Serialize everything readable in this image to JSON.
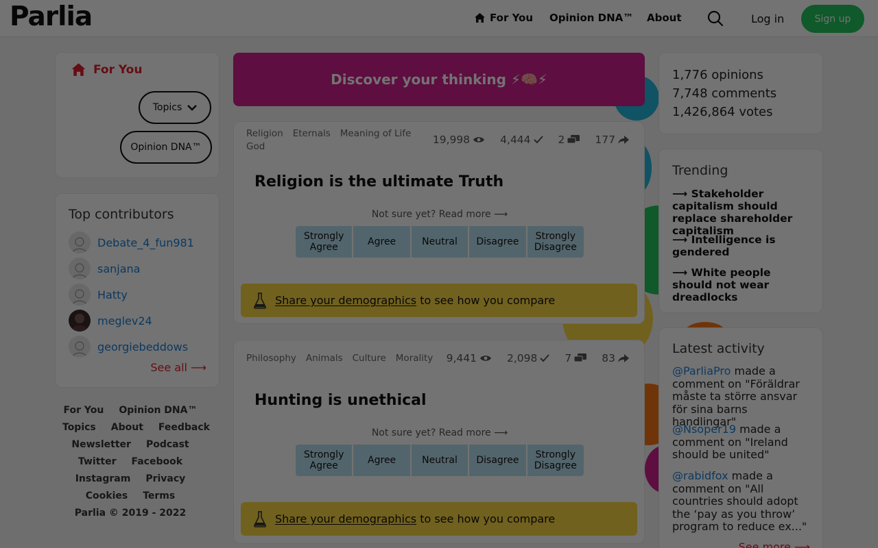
{
  "header": {
    "logo": "Parlia",
    "nav": [
      {
        "label": "For You",
        "icon": "home-icon"
      },
      {
        "label": "Opinion DNA™"
      },
      {
        "label": "About"
      }
    ],
    "login": "Log in",
    "signup": "Sign up"
  },
  "left_nav": {
    "for_you": "For You",
    "topics": "Topics",
    "opinion_dna": "Opinion DNA™"
  },
  "top_contributors": {
    "title": "Top contributors",
    "users": [
      "Debate_4_fun981",
      "sanjana",
      "Hatty",
      "meglev24",
      "georgiebeddows"
    ],
    "see_all": "See all ⟶"
  },
  "footer": {
    "rows": [
      [
        "For You",
        "Opinion DNA™"
      ],
      [
        "Topics",
        "About",
        "Feedback"
      ],
      [
        "Newsletter",
        "Podcast"
      ],
      [
        "Twitter",
        "Facebook"
      ],
      [
        "Instagram",
        "Privacy"
      ],
      [
        "Cookies",
        "Terms"
      ]
    ],
    "copyright": "Parlia © 2019 - 2022"
  },
  "banner": {
    "text": "Discover your thinking ⚡🧠⚡"
  },
  "cards": [
    {
      "tags": [
        "Religion",
        "Eternals",
        "Meaning of Life",
        "God"
      ],
      "views": "19,998",
      "votes": "4,444",
      "comments": "2",
      "shares": "177",
      "title": "Religion is the ultimate Truth",
      "readmore": "Not sure yet? Read more ⟶",
      "options": [
        "Strongly Agree",
        "Agree",
        "Neutral",
        "Disagree",
        "Strongly Disagree"
      ],
      "demo_link": "Share your demographics",
      "demo_rest": " to see how you compare"
    },
    {
      "tags": [
        "Philosophy",
        "Animals",
        "Culture",
        "Morality"
      ],
      "views": "9,441",
      "votes": "2,098",
      "comments": "7",
      "shares": "83",
      "title": "Hunting is unethical",
      "readmore": "Not sure yet? Read more ⟶",
      "options": [
        "Strongly Agree",
        "Agree",
        "Neutral",
        "Disagree",
        "Strongly Disagree"
      ],
      "demo_link": "Share your demographics",
      "demo_rest": " to see how you compare"
    }
  ],
  "site_stats": [
    "1,776 opinions",
    "7,748 comments",
    "1,426,864 votes"
  ],
  "trending": {
    "title": "Trending",
    "items": [
      "⟶ Stakeholder capitalism should replace shareholder capitalism",
      "⟶ Intelligence is gendered",
      "⟶ White people should not wear dreadlocks"
    ]
  },
  "latest": {
    "title": "Latest activity",
    "items": [
      {
        "user": "@ParliaPro",
        "text": " made a comment on \"Föräldrar måste ta större ansvar för sina barns handlingar\""
      },
      {
        "user": "@Nsoper19",
        "text": " made a comment on \"Ireland should be united\""
      },
      {
        "user": "@rabidfox",
        "text": " made a comment on \"All countries should adopt the ‘pay as you throw’ program to reduce ex...\""
      }
    ],
    "see_more": "See more ⟶"
  },
  "colors": {
    "accent_red": "#e11d2e",
    "brand_pink": "#d11f8e",
    "signup_green": "#22c55e",
    "vote_blue": "#b8dff0",
    "demo_yellow": "#fbd744",
    "link_blue": "#1a7fd6"
  }
}
